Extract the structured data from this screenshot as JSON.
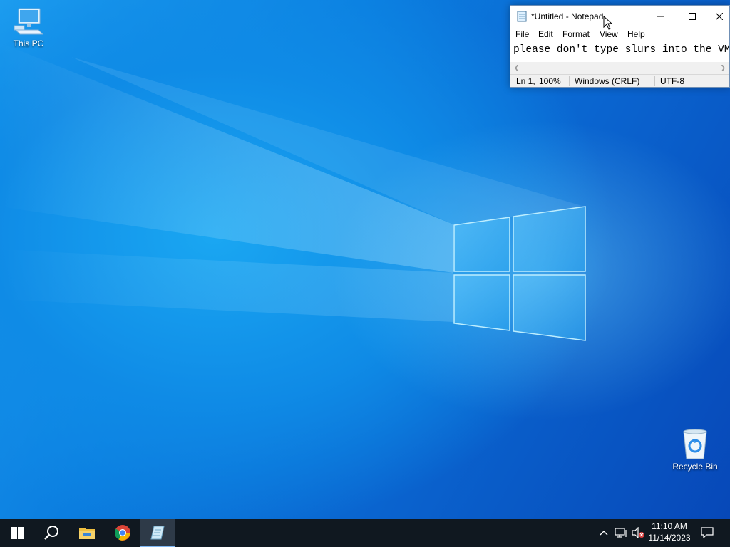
{
  "desktop": {
    "icons": [
      {
        "label": "This PC",
        "icon": "this-pc-icon"
      },
      {
        "label": "Recycle Bin",
        "icon": "recycle-bin-icon"
      }
    ]
  },
  "notepad": {
    "title": "*Untitled - Notepad",
    "menu": [
      "File",
      "Edit",
      "Format",
      "View",
      "Help"
    ],
    "content": "please don't type slurs into the VM.",
    "status": {
      "position": "Ln 1,",
      "zoom": "100%",
      "line_ending": "Windows (CRLF)",
      "encoding": "UTF-8"
    }
  },
  "taskbar": {
    "pinned": [
      "start-button",
      "search",
      "file-explorer",
      "chrome",
      "notepad"
    ],
    "clock": {
      "time": "11:10 AM",
      "date": "11/14/2023"
    }
  },
  "colors": {
    "taskbar": "#101820",
    "accent": "#7fb7f3",
    "desktop": "#0f8be6"
  }
}
